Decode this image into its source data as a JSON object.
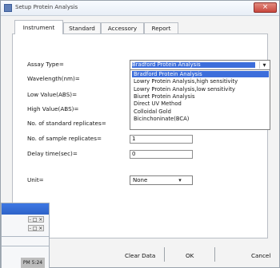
{
  "window": {
    "title": "Setup Protein Analysis",
    "close_label": "×"
  },
  "tabs": [
    {
      "label": "Instrument",
      "active": true
    },
    {
      "label": "Standard",
      "active": false
    },
    {
      "label": "Accessory",
      "active": false
    },
    {
      "label": "Report",
      "active": false
    }
  ],
  "form": {
    "assay_type_label": "Assay Type=",
    "assay_type_value": "Bradford Protein Analysis",
    "wavelength_label": "Wavelength(nm)=",
    "low_value_label": "Low Value(ABS)=",
    "high_value_label": "High Value(ABS)=",
    "standard_replicates_label": "No. of standard replicates=",
    "sample_replicates_label": "No. of sample replicates=",
    "sample_replicates_value": "1",
    "delay_label": "Delay time(sec)=",
    "delay_value": "0",
    "unit_label": "Unit=",
    "unit_value": "None"
  },
  "dropdown": {
    "options": [
      "Bradford Protein Analysis",
      "Lowry Protein Analysis,high sensitivity",
      "Lowry Protein Analysis,low sensitivity",
      "Biuret Protein Analysis",
      "Direct UV Method",
      "Colloidal Gold",
      "Bicinchoninate(BCA)"
    ],
    "selected_index": 0
  },
  "buttons": {
    "clear_data": "Clear Data",
    "ok": "OK",
    "cancel": "Cancel"
  },
  "background_window": {
    "controls_top": "- □ ×",
    "controls_bottom": "- □ ×",
    "status_text": "PM 5:24"
  }
}
